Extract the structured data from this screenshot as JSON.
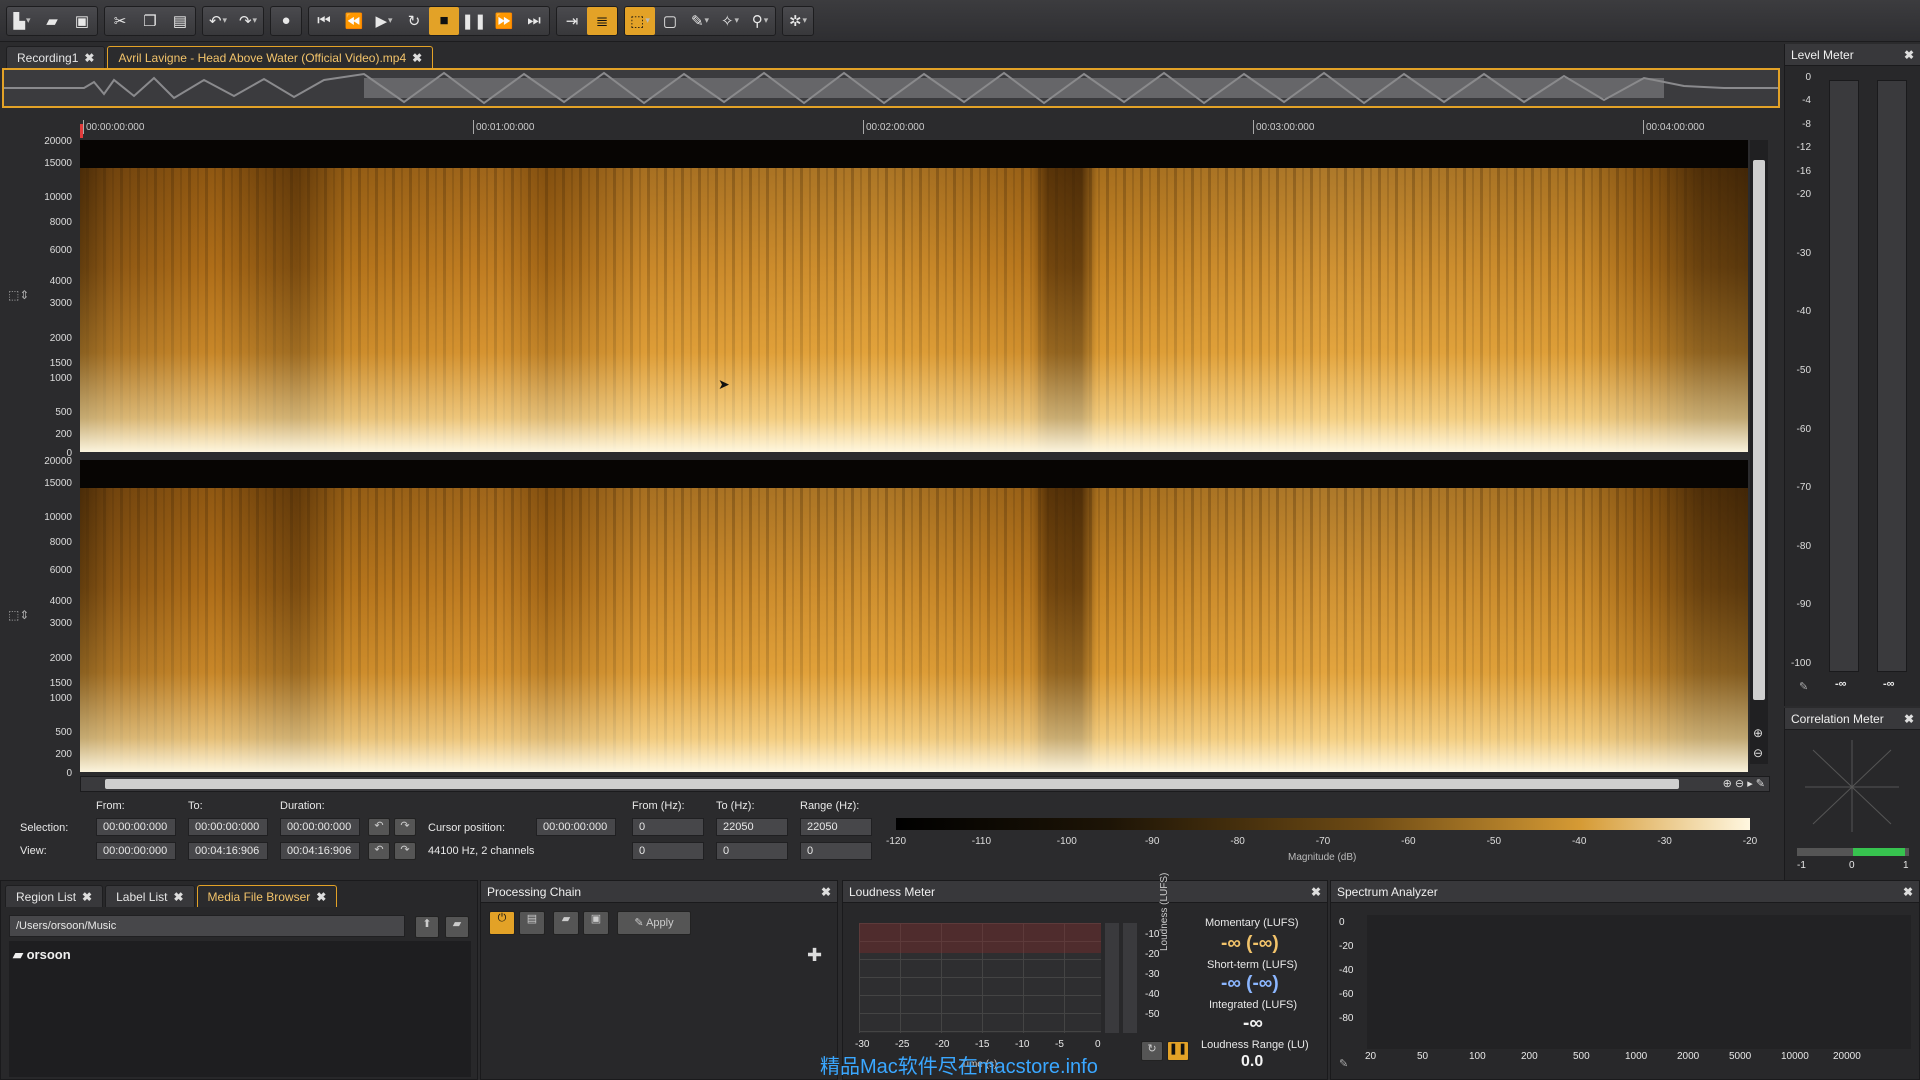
{
  "toolbar": {
    "groups": [
      [
        "new-file-icon",
        "open-folder-icon",
        "save-icon"
      ],
      [
        "cut-icon",
        "copy-icon",
        "paste-icon"
      ],
      [
        "undo-icon",
        "redo-icon"
      ],
      [
        "record-icon"
      ],
      [
        "skip-start-icon",
        "rewind-icon",
        "play-icon",
        "loop-icon",
        "stop-icon",
        "pause-icon",
        "fast-forward-icon",
        "skip-end-icon"
      ],
      [
        "follow-icon",
        "spectrogram-icon"
      ],
      [
        "select-tool-icon",
        "marquee-icon",
        "brush-icon",
        "magic-wand-icon",
        "zoom-tool-icon"
      ],
      [
        "settings-tool-icon"
      ]
    ]
  },
  "tabs": {
    "recording": "Recording1",
    "file": "Avril Lavigne - Head Above Water (Official Video).mp4"
  },
  "ruler": {
    "t0": "00:00:00:000",
    "t1": "00:01:00:000",
    "t2": "00:02:00:000",
    "t3": "00:03:00:000",
    "t4": "00:04:00:000"
  },
  "freq_labels": [
    "20000",
    "15000",
    "10000",
    "8000",
    "6000",
    "4000",
    "3000",
    "2000",
    "1500",
    "1000",
    "500",
    "200",
    "0"
  ],
  "info": {
    "from_label": "From:",
    "to_label": "To:",
    "duration_label": "Duration:",
    "selection_label": "Selection:",
    "view_label": "View:",
    "sel_from": "00:00:00:000",
    "sel_to": "00:00:00:000",
    "sel_duration": "00:00:00:000",
    "view_from": "00:00:00:000",
    "view_to": "00:04:16:906",
    "view_duration": "00:04:16:906",
    "cursor_label": "Cursor position:",
    "cursor_value": "00:00:00:000",
    "format": "44100 Hz, 2 channels",
    "from_hz_label": "From (Hz):",
    "to_hz_label": "To (Hz):",
    "range_hz_label": "Range (Hz):",
    "sel_from_hz": "0",
    "sel_to_hz": "22050",
    "sel_range_hz": "22050",
    "view_from_hz": "0",
    "view_to_hz": "0",
    "view_range_hz": "0"
  },
  "magnitude": {
    "ticks": [
      "-120",
      "-110",
      "-100",
      "-90",
      "-80",
      "-70",
      "-60",
      "-50",
      "-40",
      "-30",
      "-20"
    ],
    "label": "Magnitude (dB)"
  },
  "level_meter": {
    "title": "Level Meter",
    "scale": [
      "0",
      "-4",
      "-8",
      "-12",
      "-16",
      "-20",
      "-30",
      "-40",
      "-50",
      "-60",
      "-70",
      "-80",
      "-90",
      "-100"
    ],
    "left_value": "-∞",
    "right_value": "-∞"
  },
  "correlation_meter": {
    "title": "Correlation Meter",
    "scale": [
      "-1",
      "0",
      "1"
    ]
  },
  "bottom_tabs": {
    "region": "Region List",
    "label": "Label List",
    "media": "Media File Browser"
  },
  "media_browser": {
    "path": "/Users/orsoon/Music",
    "folder": "orsoon"
  },
  "processing_chain": {
    "title": "Processing Chain",
    "apply": "Apply"
  },
  "loudness_meter": {
    "title": "Loudness Meter",
    "x_ticks": [
      "-30",
      "-25",
      "-20",
      "-15",
      "-10",
      "-5",
      "0"
    ],
    "y_ticks": [
      "-10",
      "-20",
      "-30",
      "-40",
      "-50"
    ],
    "y_axis_label": "Loudness (LUFS)",
    "x_axis_label": "Time (s)",
    "momentary_label": "Momentary (LUFS)",
    "momentary_value": "-∞ (-∞)",
    "shortterm_label": "Short-term (LUFS)",
    "shortterm_value": "-∞ (-∞)",
    "integrated_label": "Integrated (LUFS)",
    "integrated_value": "-∞",
    "range_label": "Loudness Range (LU)",
    "range_value": "0.0"
  },
  "spectrum_analyzer": {
    "title": "Spectrum Analyzer",
    "y_ticks": [
      "0",
      "-20",
      "-40",
      "-60",
      "-80"
    ],
    "x_ticks": [
      "20",
      "50",
      "100",
      "200",
      "500",
      "1000",
      "2000",
      "5000",
      "10000",
      "20000"
    ]
  },
  "watermark": "精品Mac软件尽在macstore.info"
}
